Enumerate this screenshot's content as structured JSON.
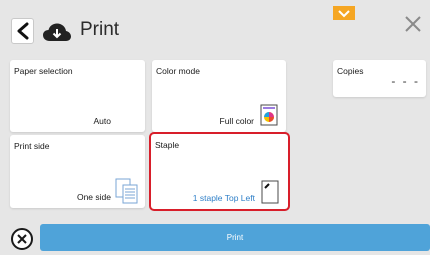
{
  "header": {
    "title": "Print",
    "back_icon": "chevron-left-icon",
    "cloud_icon": "cloud-download-icon",
    "close_icon": "close-icon",
    "accent_notch_color": "#f5a623"
  },
  "tiles": {
    "paper_selection": {
      "label": "Paper selection",
      "value": "Auto"
    },
    "color_mode": {
      "label": "Color mode",
      "value": "Full color",
      "icon": "color-palette-icon"
    },
    "print_side": {
      "label": "Print side",
      "value": "One side",
      "icon": "one-side-pages-icon"
    },
    "staple": {
      "label": "Staple",
      "value": "1 staple Top Left",
      "icon": "staple-top-left-icon",
      "highlight_color": "#d81e2a"
    },
    "copies": {
      "label": "Copies",
      "value": "- - -"
    }
  },
  "footer": {
    "print_label": "Print",
    "cancel_icon": "cancel-circle-icon",
    "print_color": "#4fa3d9"
  }
}
